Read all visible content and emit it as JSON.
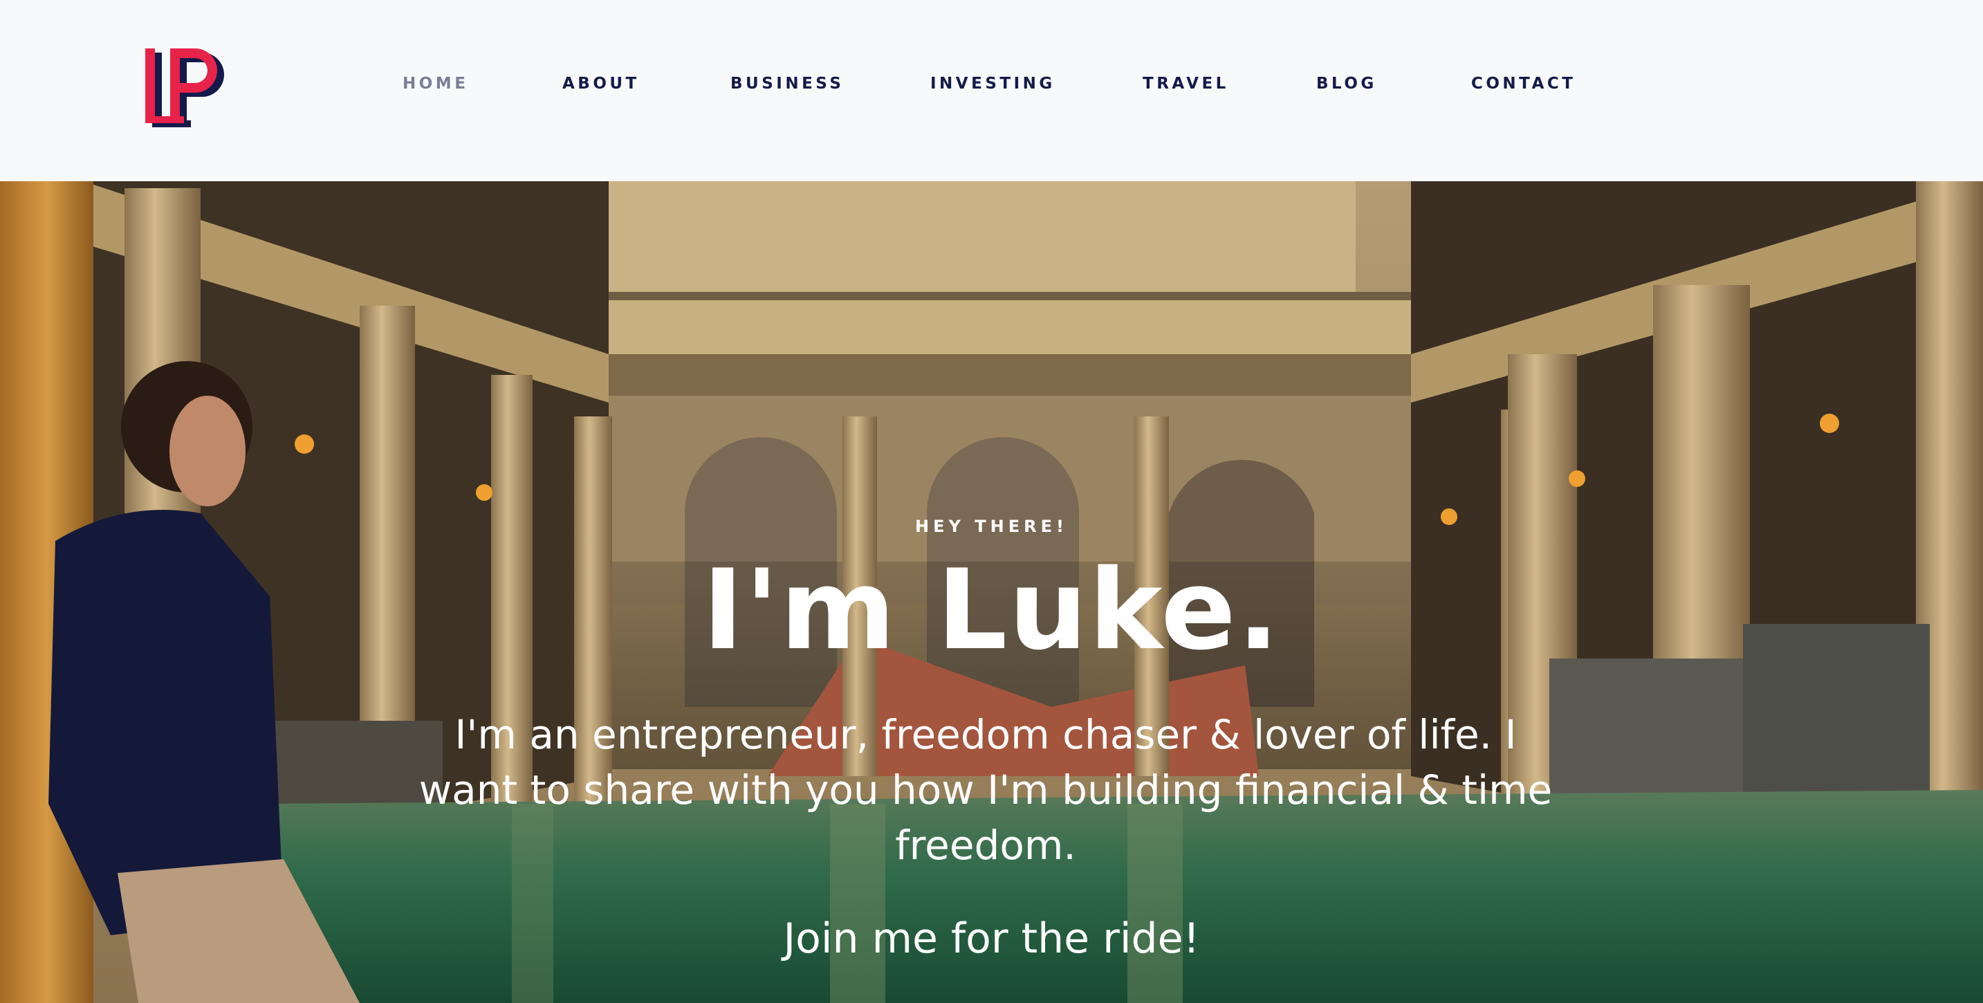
{
  "logo": {
    "text": "LP",
    "primary_color": "#e8234a",
    "secondary_color": "#141a4a"
  },
  "nav": {
    "items": [
      {
        "label": "HOME",
        "active": true
      },
      {
        "label": "ABOUT",
        "active": false
      },
      {
        "label": "BUSINESS",
        "active": false
      },
      {
        "label": "INVESTING",
        "active": false
      },
      {
        "label": "TRAVEL",
        "active": false
      },
      {
        "label": "BLOG",
        "active": false
      },
      {
        "label": "CONTACT",
        "active": false
      }
    ],
    "text_color": "#141a4a",
    "active_color": "#7a7f98"
  },
  "hero": {
    "eyebrow": "HEY THERE!",
    "headline": "I'm Luke.",
    "intro": "I'm an entrepreneur, freedom chaser & lover of life. I want to share with you how I'm building financial & time freedom.",
    "cta": "Join me for the ride!",
    "background": "roman-baths-photo"
  }
}
